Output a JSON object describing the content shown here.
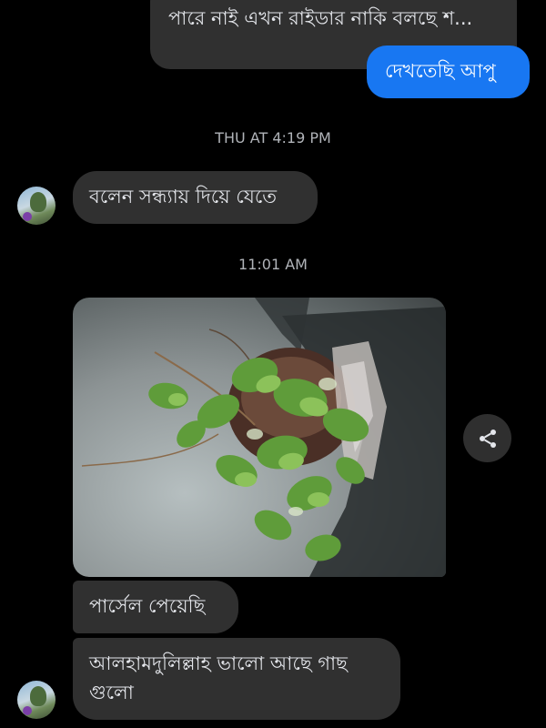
{
  "conversation": {
    "messages": [
      {
        "direction": "incoming",
        "text": "পারে নাই এখন রাইডার নাকি বলছে শ..."
      },
      {
        "direction": "outgoing",
        "text": "দেখতেছি আপু"
      },
      {
        "direction": "incoming",
        "text": "বলেন সন্ধ্যায় দিয়ে যেতে"
      },
      {
        "direction": "incoming",
        "text": "পার্সেল পেয়েছি"
      },
      {
        "direction": "incoming",
        "text": "আলহামদুলিল্লাহ ভালো আছে গাছ গুলো"
      }
    ],
    "timestamps": [
      "THU AT 4:19 PM",
      "11:01 AM"
    ]
  },
  "icons": {
    "share": "share-icon",
    "avatar": "avatar"
  },
  "colors": {
    "background": "#000000",
    "incoming_bubble": "#303030",
    "outgoing_bubble": "#1877f2",
    "timestamp_text": "#b0b3b8"
  }
}
